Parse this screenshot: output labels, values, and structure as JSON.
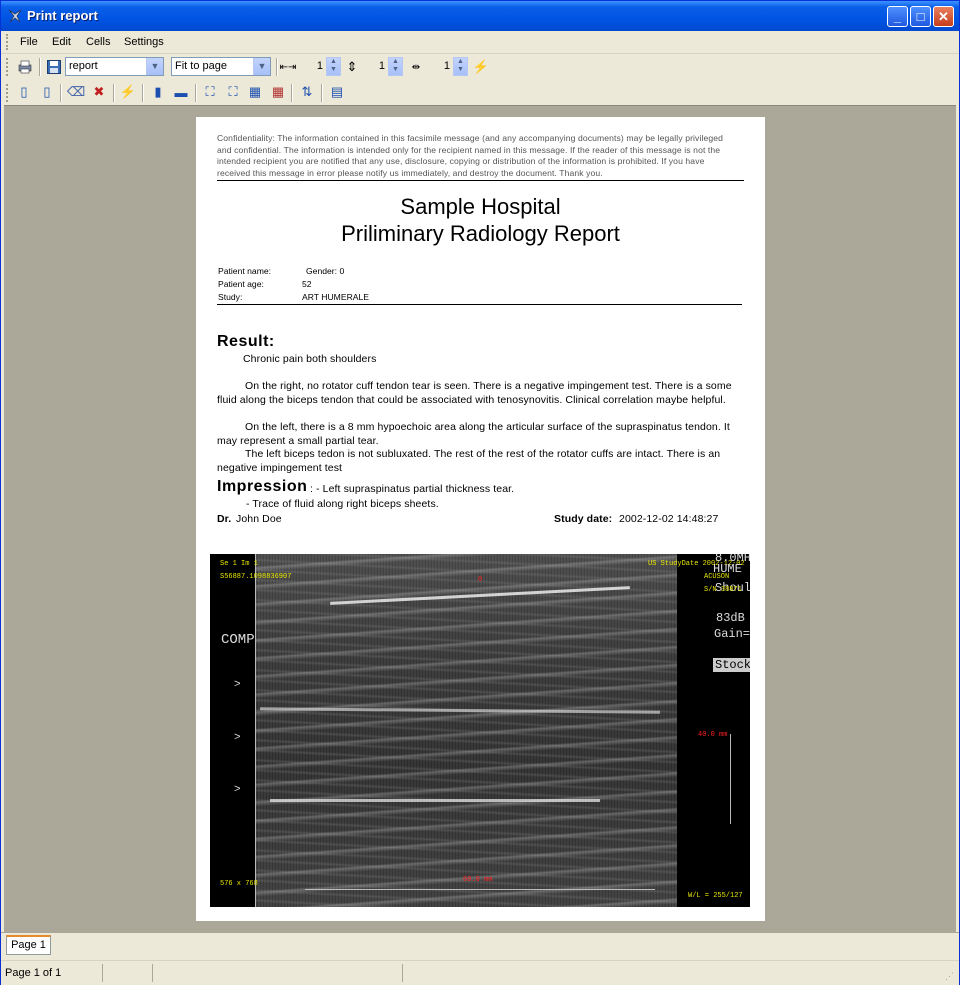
{
  "window": {
    "title": "Print report"
  },
  "menu": [
    "File",
    "Edit",
    "Cells",
    "Settings"
  ],
  "toolbar1": {
    "report_select": "report",
    "fit_select": "Fit to page",
    "spin_h": "1",
    "spin_v": "1",
    "spin_both": "1"
  },
  "report": {
    "confidentiality": "Confidentiality: The information contained in this facsimile message (and any accompanying documents) may be legally privileged and confidential.  The information is intended only for the recipient named in this message.  If the reader of this message is not the intended recipient you are notified that any use, disclosure, copying or distribution of the information is prohibited. If you have received this message in error please notify us immediately, and destroy the document. Thank you.",
    "hospital": "Sample Hospital",
    "report_title": "Priliminary Radiology Report",
    "patient_name_label": "Patient name:",
    "patient_name_value": "Gender: 0",
    "patient_age_label": "Patient age:",
    "patient_age_value": "52",
    "study_label": "Study:",
    "study_value": "ART HUMERALE",
    "result_heading": "Result:",
    "result_line1": "Chronic pain both shoulders",
    "result_p1": "On the right, no rotator cuff tendon tear is seen. There is a negative impingement test. There is a some fluid along the biceps tendon that could be associated with tenosynovitis. Clinical correlation maybe helpful.",
    "result_p2": "On the left, there is a 8 mm hypoechoic area along the articular surface of the supraspinatus tendon. It may represent a small partial tear.",
    "result_p3": "The left biceps tedon is not subluxated. The rest of the rest of the rotator cuffs are intact. There is an negative impingement test",
    "impression_heading": "Impression",
    "impression_1": ": - Left supraspinatus partial thickness tear.",
    "impression_2": "- Trace of fluid along right biceps sheets.",
    "doctor_label": "Dr.",
    "doctor_name": "John Doe",
    "study_date_label": "Study date:",
    "study_date_value": "2002-12-02 14:48:27"
  },
  "ultrasound": {
    "top_left_1": "Se 1 Im 1",
    "top_left_2": "S56887.1098836907",
    "comp": "COMP",
    "bottom_left": "576 x 768",
    "top_right": "US StudyDate 2002-12-02",
    "acuson": "ACUSON",
    "sn": "S/N 38871",
    "freq": "8.0MHz",
    "side_hume": "HUME",
    "side_shr": "Shoulder",
    "db": "83dB",
    "gain": "Gain=",
    "stock": "Stock",
    "depth": "40.0 mm",
    "wl": "W/L = 255/127",
    "red_top": "0",
    "red_bottom": "60.0 mm"
  },
  "tabs": [
    "Page 1"
  ],
  "status": {
    "page": "Page 1 of 1"
  }
}
